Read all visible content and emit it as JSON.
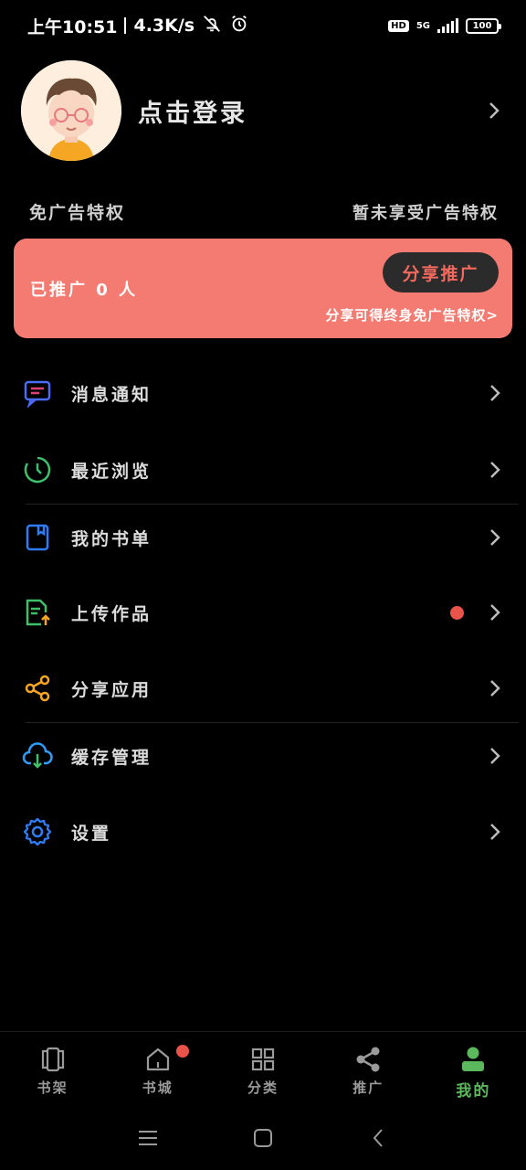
{
  "status_bar": {
    "time": "上午10:51",
    "speed": "4.3K/s",
    "hd": "HD",
    "network": "5G",
    "battery": "100"
  },
  "profile": {
    "login_label": "点击登录"
  },
  "ad_privilege": {
    "title": "免广告特权",
    "status": "暂未享受广告特权"
  },
  "promo": {
    "count_text": "已推广 0 人",
    "button_label": "分享推广",
    "hint": "分享可得终身免广告特权>"
  },
  "menu": {
    "items": [
      {
        "label": "消息通知",
        "icon": "message-icon"
      },
      {
        "label": "最近浏览",
        "icon": "clock-icon"
      },
      {
        "label": "我的书单",
        "icon": "book-icon"
      },
      {
        "label": "上传作品",
        "icon": "upload-doc-icon",
        "has_dot": true
      },
      {
        "label": "分享应用",
        "icon": "share-icon"
      },
      {
        "label": "缓存管理",
        "icon": "cloud-download-icon"
      },
      {
        "label": "设置",
        "icon": "gear-icon"
      }
    ]
  },
  "tabbar": {
    "tabs": [
      {
        "label": "书架",
        "icon": "bookshelf-icon"
      },
      {
        "label": "书城",
        "icon": "home-icon",
        "badge": true
      },
      {
        "label": "分类",
        "icon": "grid-icon"
      },
      {
        "label": "推广",
        "icon": "share-icon"
      },
      {
        "label": "我的",
        "icon": "user-icon",
        "active": true
      }
    ]
  },
  "colors": {
    "accent_green": "#5cb85c",
    "promo_bg": "#f47b71",
    "badge_red": "#e8534a"
  }
}
